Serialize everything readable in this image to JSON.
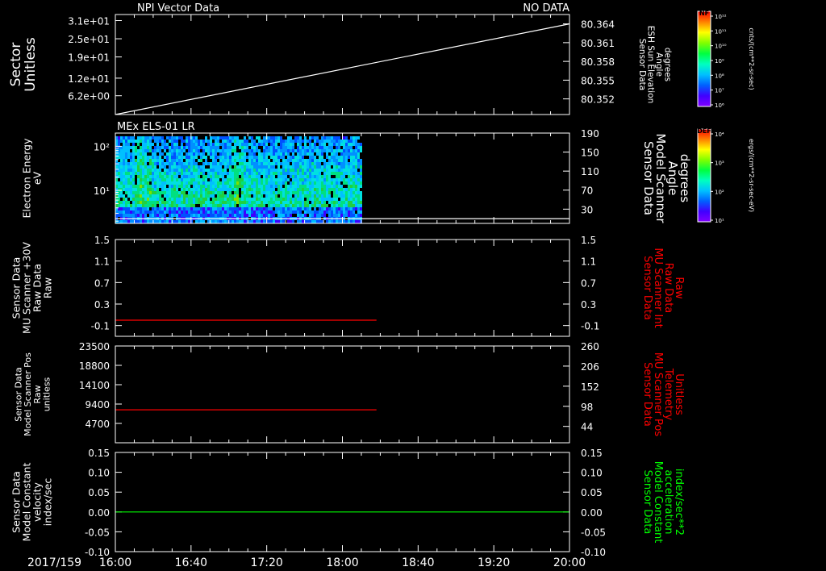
{
  "header": {
    "left_title": "NPI Vector Data",
    "right_title": "NO DATA",
    "panel2_title": "MEx ELS-01 LR"
  },
  "time_axis": {
    "date_label": "2017/159",
    "ticks": [
      "16:00",
      "16:40",
      "17:20",
      "18:00",
      "18:40",
      "19:20",
      "20:00"
    ],
    "start_min": 960,
    "end_min": 1200
  },
  "colorbars": {
    "nf": {
      "tag": "NF",
      "unit": "cnts/(cm**2-sr-sec)",
      "ticks": [
        "10¹²",
        "10¹¹",
        "10¹⁰",
        "10⁹",
        "10⁸",
        "10⁷",
        "10⁶"
      ]
    },
    "def": {
      "tag": "DEF",
      "unit": "ergs/(cm**2-sr-sec-eV)",
      "ticks": [
        "10⁴",
        "10³",
        "10²",
        "10¹"
      ]
    }
  },
  "colors": {
    "axis": "#ffffff",
    "red_trace": "#ff0000",
    "green_trace": "#00ff00",
    "green_label": "#00ff00",
    "red_label": "#ff0000"
  },
  "chart_data": [
    {
      "type": "line",
      "panel": "sector",
      "ylabel": [
        "Sector",
        "Unitless"
      ],
      "left_ticks": [
        "3.1e+01",
        "2.5e+01",
        "1.9e+01",
        "1.2e+01",
        "6.2e+00"
      ],
      "left_tick_values": [
        31,
        25,
        19,
        12,
        6.2
      ],
      "ylim": [
        0,
        33
      ],
      "right_label": [
        "Sensor Data",
        "ESH Sun Elevation",
        "Angle",
        "degrees"
      ],
      "right_ticks": [
        "80.364",
        "80.361",
        "80.358",
        "80.355",
        "80.352"
      ],
      "right_tick_values": [
        80.364,
        80.361,
        80.358,
        80.355,
        80.352
      ],
      "right_ylim": [
        80.3495,
        80.3655
      ],
      "series": [
        {
          "axis": "right",
          "color": "#ffffff",
          "x": [
            960,
            1200
          ],
          "y": [
            80.3495,
            80.364
          ]
        }
      ]
    },
    {
      "type": "heatmap",
      "panel": "els",
      "ylabel": [
        "Electron Energy",
        "eV"
      ],
      "left_ticks": [
        "10²",
        "10¹"
      ],
      "log_range": [
        0.25,
        2.3
      ],
      "data_x_end_min": 1090,
      "right_label": [
        "Sensor Data",
        "Model Scanner",
        "Angle",
        "degrees"
      ],
      "right_ticks": [
        "190",
        "150",
        "110",
        "70",
        "30"
      ],
      "right_tick_values": [
        190,
        150,
        110,
        70,
        30
      ],
      "right_ylim": [
        0,
        190
      ],
      "series": [
        {
          "axis": "right",
          "color": "#ffffff",
          "x": [
            960,
            1200
          ],
          "y": [
            10,
            10
          ]
        }
      ]
    },
    {
      "type": "line",
      "panel": "mu_int",
      "ylabel": [
        "Sensor Data",
        "MU Scanner +30V",
        "Raw Data",
        "Raw"
      ],
      "left_ticks": [
        "1.5",
        "1.1",
        "0.7",
        "0.3",
        "-0.1"
      ],
      "left_tick_values": [
        1.5,
        1.1,
        0.7,
        0.3,
        -0.1
      ],
      "ylim": [
        -0.3,
        1.5
      ],
      "right_label": [
        "Sensor Data",
        "MU Scanner Int",
        "Raw Data",
        "Raw"
      ],
      "right_ticks": [
        "1.5",
        "1.1",
        "0.7",
        "0.3",
        "-0.1"
      ],
      "right_tick_values": [
        1.5,
        1.1,
        0.7,
        0.3,
        -0.1
      ],
      "right_label_color": "#ff0000",
      "series": [
        {
          "axis": "left",
          "color": "#ff0000",
          "x": [
            960,
            1098
          ],
          "y": [
            0.0,
            0.0
          ]
        }
      ]
    },
    {
      "type": "line",
      "panel": "mu_pos",
      "ylabel": [
        "Sensor Data",
        "Model Scanner Pos",
        "Raw",
        "unitless"
      ],
      "left_ticks": [
        "23500",
        "18800",
        "14100",
        "9400",
        "4700"
      ],
      "left_tick_values": [
        23500,
        18800,
        14100,
        9400,
        4700
      ],
      "ylim": [
        0,
        23500
      ],
      "right_label": [
        "Sensor Data",
        "MU Scanner Pos",
        "Telemetry",
        "Unitless"
      ],
      "right_ticks": [
        "260",
        "206",
        "152",
        "98",
        "44"
      ],
      "right_tick_values": [
        260,
        206,
        152,
        98,
        44
      ],
      "right_label_color": "#ff0000",
      "series": [
        {
          "axis": "left",
          "color": "#ff0000",
          "x": [
            960,
            1098
          ],
          "y": [
            8000,
            8000
          ]
        }
      ]
    },
    {
      "type": "line",
      "panel": "model_const",
      "ylabel": [
        "Sensor Data",
        "Model Constant",
        "velocity",
        "index/sec"
      ],
      "left_ticks": [
        "0.15",
        "0.10",
        "0.05",
        "0.00",
        "-0.05",
        "-0.10"
      ],
      "left_tick_values": [
        0.15,
        0.1,
        0.05,
        0.0,
        -0.05,
        -0.1
      ],
      "ylim": [
        -0.1,
        0.15
      ],
      "right_label": [
        "Sensor Data",
        "Model Constant",
        "acceleration",
        "index/sec**2"
      ],
      "right_ticks": [
        "0.15",
        "0.10",
        "0.05",
        "0.00",
        "-0.05",
        "-0.10"
      ],
      "right_tick_values": [
        0.15,
        0.1,
        0.05,
        0.0,
        -0.05,
        -0.1
      ],
      "right_label_color": "#00ff00",
      "series": [
        {
          "axis": "left",
          "color": "#00ff00",
          "x": [
            960,
            1200
          ],
          "y": [
            0.0,
            0.0
          ]
        }
      ]
    }
  ]
}
